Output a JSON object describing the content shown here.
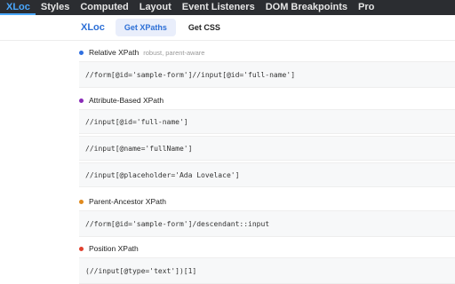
{
  "devtools_tabs": [
    "XLoc",
    "Styles",
    "Computed",
    "Layout",
    "Event Listeners",
    "DOM Breakpoints",
    "Pro"
  ],
  "extension": {
    "brand": "XLoc",
    "tabs": [
      "Get XPaths",
      "Get CSS"
    ],
    "active_tab": "Get XPaths"
  },
  "sections": [
    {
      "title": "Relative XPath",
      "hint": "robust, parent-aware",
      "dot_color": "#2f6fe0",
      "xpaths": [
        "//form[@id='sample-form']//input[@id='full-name']"
      ]
    },
    {
      "title": "Attribute-Based XPath",
      "hint": "",
      "dot_color": "#8a2bb8",
      "xpaths": [
        "//input[@id='full-name']",
        "//input[@name='fullName']",
        "//input[@placeholder='Ada Lovelace']"
      ]
    },
    {
      "title": "Parent-Ancestor XPath",
      "hint": "",
      "dot_color": "#e08a1e",
      "xpaths": [
        "//form[@id='sample-form']/descendant::input"
      ]
    },
    {
      "title": "Position XPath",
      "hint": "",
      "dot_color": "#e0402e",
      "xpaths": [
        "(//input[@type='text'])[1]"
      ]
    }
  ]
}
